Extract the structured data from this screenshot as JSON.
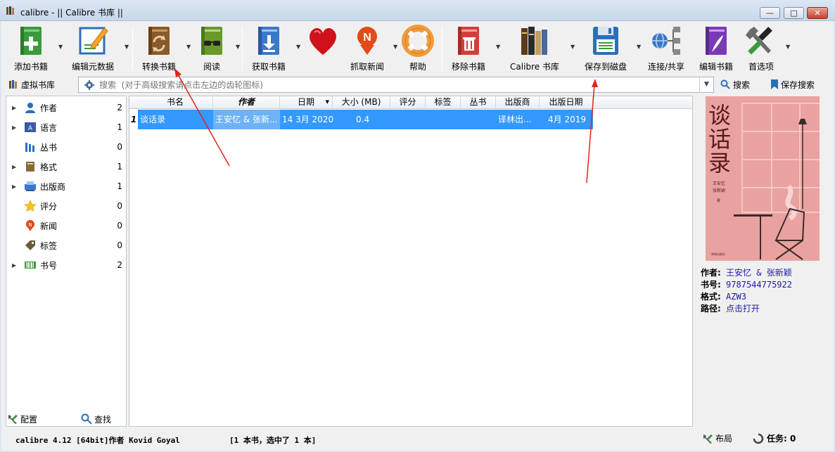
{
  "window": {
    "title": "calibre - || Calibre 书库 ||",
    "min": "—",
    "max": "□",
    "close": "✕"
  },
  "toolbar": {
    "add": "添加书籍",
    "edit_meta": "编辑元数据",
    "convert": "转换书籍",
    "read": "阅读",
    "get_books": "获取书籍",
    "donate": "",
    "fetch_news": "抓取新闻",
    "help": "帮助",
    "remove": "移除书籍",
    "library": "Calibre 书库",
    "save": "保存到磁盘",
    "connect": "连接/共享",
    "edit_book": "编辑书籍",
    "prefs": "首选项"
  },
  "search": {
    "virtual_library": "虚拟书库",
    "placeholder": "搜索  (对于高级搜索请点击左边的齿轮图标)",
    "search_btn": "搜索",
    "save_search_btn": "保存搜索"
  },
  "tags": {
    "items": [
      {
        "name": "作者",
        "count": "2",
        "expandable": true
      },
      {
        "name": "语言",
        "count": "1",
        "expandable": true
      },
      {
        "name": "丛书",
        "count": "0",
        "expandable": false
      },
      {
        "name": "格式",
        "count": "1",
        "expandable": true
      },
      {
        "name": "出版商",
        "count": "1",
        "expandable": true
      },
      {
        "name": "评分",
        "count": "0",
        "expandable": false
      },
      {
        "name": "新闻",
        "count": "0",
        "expandable": false
      },
      {
        "name": "标签",
        "count": "0",
        "expandable": false
      },
      {
        "name": "书号",
        "count": "2",
        "expandable": true
      }
    ],
    "configure": "配置",
    "find": "查找"
  },
  "books": {
    "columns": [
      "书名",
      "作者",
      "日期",
      "大小 (MB)",
      "评分",
      "标签",
      "丛书",
      "出版商",
      "出版日期"
    ],
    "sort_indicator": "▼",
    "rows": [
      {
        "num": "1",
        "title": "谈话录",
        "author": "王安忆 & 张新...",
        "date": "14 3月 2020",
        "size": "0.4",
        "rating": "",
        "tags": "",
        "series": "",
        "publisher": "译林出...",
        "pubdate": "4月 2019"
      }
    ]
  },
  "cover": {
    "title_chars": [
      "谈",
      "话",
      "录"
    ],
    "authors_line1": "王安忆",
    "authors_line2": "张新颖",
    "suffix": "著",
    "publisher_mark": "译林出版社"
  },
  "details": {
    "author_label": "作者:",
    "author_value": "王安忆 & 张新颖",
    "isbn_label": "书号:",
    "isbn_value": "9787544775922",
    "format_label": "格式:",
    "format_value": "AZW3",
    "path_label": "路径:",
    "path_value": "点击打开"
  },
  "status": {
    "version": "calibre 4.12 [64bit]作者 Kovid Goyal",
    "selection": "[1 本书，选中了 1 本]",
    "layout": "布局",
    "jobs": "任务:  0"
  },
  "colors": {
    "selection": "#3399ff",
    "accent_red": "#e2231a",
    "link": "#1a1aa6"
  }
}
